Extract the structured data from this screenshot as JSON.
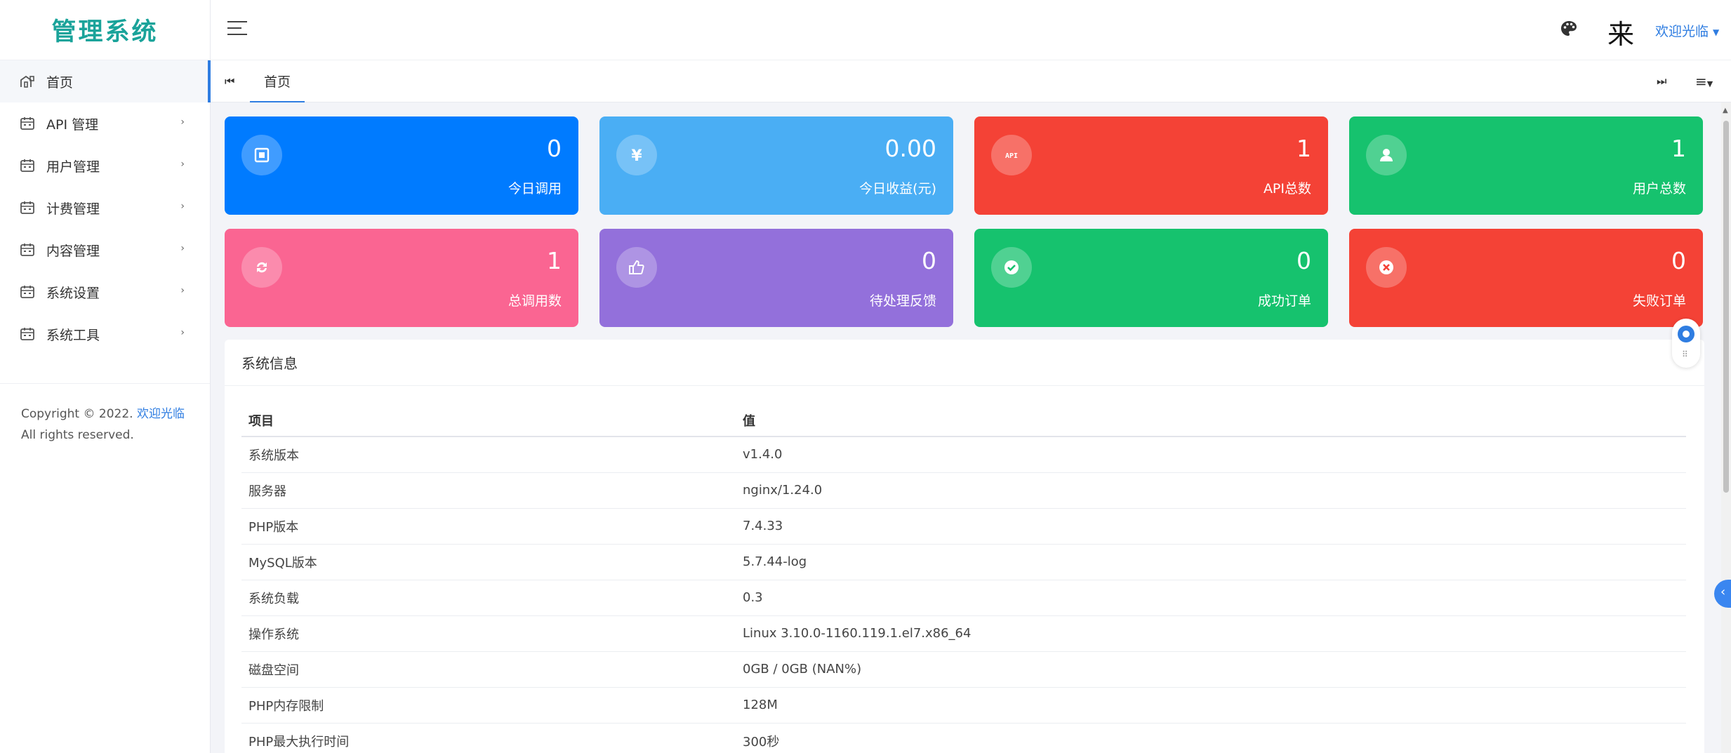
{
  "app": {
    "title": "管理系统"
  },
  "header": {
    "char": "来",
    "user": "欢迎光临"
  },
  "sidebar": {
    "items": [
      {
        "label": "首页",
        "icon": "home-icon"
      },
      {
        "label": "API 管理",
        "icon": "calendar-icon"
      },
      {
        "label": "用户管理",
        "icon": "calendar-icon"
      },
      {
        "label": "计费管理",
        "icon": "calendar-icon"
      },
      {
        "label": "内容管理",
        "icon": "calendar-icon"
      },
      {
        "label": "系统设置",
        "icon": "calendar-icon"
      },
      {
        "label": "系统工具",
        "icon": "calendar-icon"
      }
    ],
    "footer": {
      "prefix": "Copyright © 2022.",
      "link": "欢迎光临",
      "suffix": "All rights reserved."
    }
  },
  "tabs": {
    "active": "首页"
  },
  "cards": [
    {
      "value": "0",
      "label": "今日调用",
      "color": "#007bff",
      "icon": "counter-icon"
    },
    {
      "value": "0.00",
      "label": "今日收益(元)",
      "color": "#4aaef4",
      "icon": "yen-icon"
    },
    {
      "value": "1",
      "label": "API总数",
      "color": "#f44236",
      "icon": "api-icon"
    },
    {
      "value": "1",
      "label": "用户总数",
      "color": "#16c26e",
      "icon": "user-icon"
    },
    {
      "value": "1",
      "label": "总调用数",
      "color": "#fa6592",
      "icon": "refresh-icon"
    },
    {
      "value": "0",
      "label": "待处理反馈",
      "color": "#9370db",
      "icon": "thumbs-up-icon"
    },
    {
      "value": "0",
      "label": "成功订单",
      "color": "#16c26e",
      "icon": "check-circle-icon"
    },
    {
      "value": "0",
      "label": "失败订单",
      "color": "#f44236",
      "icon": "x-circle-icon"
    }
  ],
  "system_info": {
    "title": "系统信息",
    "headers": [
      "项目",
      "值"
    ],
    "rows": [
      [
        "系统版本",
        "v1.4.0"
      ],
      [
        "服务器",
        "nginx/1.24.0"
      ],
      [
        "PHP版本",
        "7.4.33"
      ],
      [
        "MySQL版本",
        "5.7.44-log"
      ],
      [
        "系统负载",
        "0.3"
      ],
      [
        "操作系统",
        "Linux 3.10.0-1160.119.1.el7.x86_64"
      ],
      [
        "磁盘空间",
        "0GB / 0GB (NAN%)"
      ],
      [
        "PHP内存限制",
        "128M"
      ],
      [
        "PHP最大执行时间",
        "300秒"
      ]
    ]
  }
}
